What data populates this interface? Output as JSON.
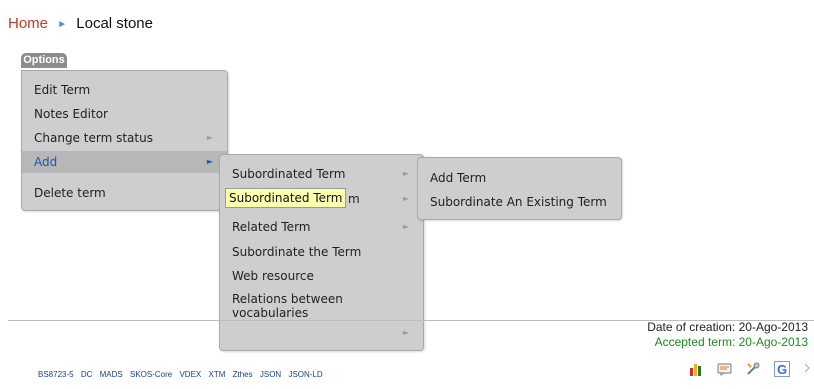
{
  "breadcrumb": {
    "home": "Home",
    "separator": "►",
    "current": "Local stone"
  },
  "options": {
    "label": "Options"
  },
  "menu_main": {
    "items": [
      {
        "label": "Edit Term",
        "submenu": false,
        "active": false
      },
      {
        "label": "Notes Editor",
        "submenu": false,
        "active": false
      },
      {
        "label": "Change term status",
        "submenu": true,
        "active": false
      },
      {
        "label": "Add",
        "submenu": true,
        "active": true
      },
      {
        "label": "Delete term",
        "submenu": false,
        "active": false
      }
    ]
  },
  "menu_add": {
    "items": [
      {
        "label": "Subordinated Term",
        "submenu": true
      },
      {
        "label": "m",
        "submenu": true
      },
      {
        "label": "Related Term",
        "submenu": true
      },
      {
        "label": "Subordinate the Term",
        "submenu": false
      },
      {
        "label": "Web resource",
        "submenu": false
      },
      {
        "label": "Relations between vocabularies",
        "submenu": true
      }
    ]
  },
  "menu_subordinated": {
    "items": [
      {
        "label": "Add Term"
      },
      {
        "label": "Subordinate An Existing Term"
      }
    ]
  },
  "tooltip": {
    "text": "Subordinated Term"
  },
  "dates": {
    "created": "Date of creation: 20-Ago-2013",
    "accepted": "Accepted term: 20-Ago-2013"
  },
  "formats": [
    "BS8723-5",
    "DC",
    "MADS",
    "SKOS-Core",
    "VDEX",
    "XTM",
    "Zthes",
    "JSON",
    "JSON-LD"
  ],
  "footer_icons": [
    "chart-icon",
    "message-icon",
    "tools-icon",
    "google-icon",
    "edge-icon"
  ],
  "colors": {
    "home_link": "#c0392b",
    "active_item": "#1a56b8",
    "accepted": "#1e8b1e",
    "format_links": "#1d3f8a"
  }
}
